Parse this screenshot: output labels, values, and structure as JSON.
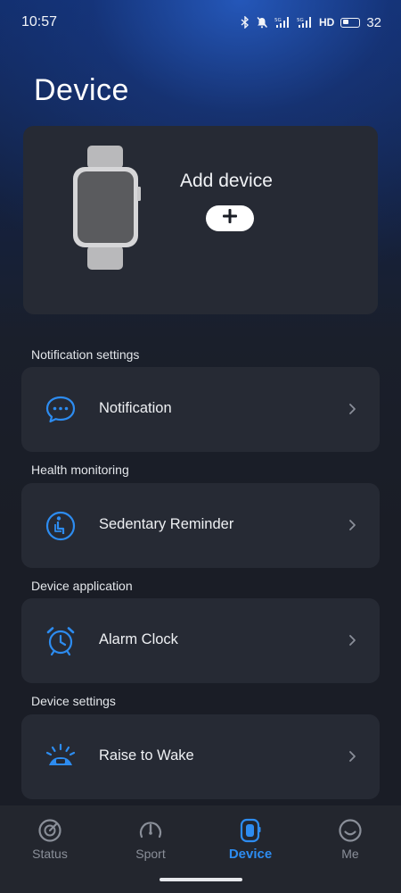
{
  "status_bar": {
    "time": "10:57",
    "network_label": "HD",
    "battery_level": "32",
    "icons": [
      "bluetooth-icon",
      "mute-icon",
      "signal-5g-icon",
      "signal-5g-icon",
      "hd-icon",
      "battery-icon"
    ]
  },
  "page": {
    "title": "Device"
  },
  "device_card": {
    "add_label": "Add device",
    "add_icon": "plus-icon"
  },
  "sections": [
    {
      "label": "Notification settings",
      "item": "Notification",
      "icon": "chat-bubble-icon"
    },
    {
      "label": "Health monitoring",
      "item": "Sedentary Reminder",
      "icon": "sedentary-person-icon"
    },
    {
      "label": "Device application",
      "item": "Alarm Clock",
      "icon": "alarm-clock-icon"
    },
    {
      "label": "Device settings",
      "item": "Raise to Wake",
      "icon": "raise-wrist-icon"
    }
  ],
  "bottom_nav": {
    "items": [
      {
        "label": "Status",
        "icon": "status-gauge-icon",
        "active": false
      },
      {
        "label": "Sport",
        "icon": "speedometer-icon",
        "active": false
      },
      {
        "label": "Device",
        "icon": "watch-icon",
        "active": true
      },
      {
        "label": "Me",
        "icon": "smiley-icon",
        "active": false
      }
    ]
  },
  "colors": {
    "accent": "#2d8cf0",
    "card": "#262a34",
    "background": "#1a1d26"
  }
}
